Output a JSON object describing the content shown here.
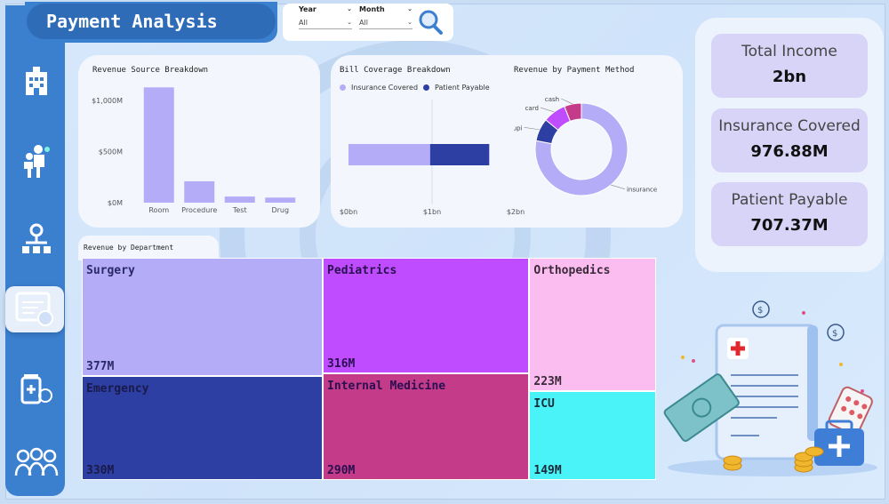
{
  "title": "Payment Analysis",
  "filters": {
    "year_label": "Year",
    "year_value": "All",
    "month_label": "Month",
    "month_value": "All"
  },
  "sidebar": {
    "items": [
      {
        "icon": "hospital-icon"
      },
      {
        "icon": "staff-icon"
      },
      {
        "icon": "org-chart-icon"
      },
      {
        "icon": "billing-icon",
        "active": true
      },
      {
        "icon": "medicine-icon"
      },
      {
        "icon": "patients-icon"
      }
    ]
  },
  "revenue_source": {
    "title": "Revenue Source Breakdown",
    "chart_data": {
      "type": "bar",
      "categories": [
        "Room",
        "Procedure",
        "Test",
        "Drug"
      ],
      "values": [
        1130,
        210,
        60,
        50
      ],
      "ylim": [
        0,
        1150
      ],
      "yticks": [
        "$0M",
        "$500M",
        "$1,000M"
      ],
      "ytick_values": [
        0,
        500,
        1000
      ],
      "color": "#b5acf8"
    }
  },
  "bill_coverage": {
    "title": "Bill Coverage Breakdown",
    "chart_data": {
      "type": "bar",
      "orientation": "horizontal",
      "stacked": true,
      "series": [
        {
          "name": "Insurance Covered",
          "values": [
            976.88
          ],
          "color": "#b5acf8"
        },
        {
          "name": "Patient Payable",
          "values": [
            707.37
          ],
          "color": "#2e3fa3"
        }
      ],
      "xticks": [
        "$0bn",
        "$1bn",
        "$2bn"
      ],
      "xtick_values": [
        0,
        1000,
        2000
      ],
      "xlim": [
        0,
        2000
      ]
    }
  },
  "payment_method": {
    "title": "Revenue by Payment Method",
    "chart_data": {
      "type": "pie",
      "donut": true,
      "labels": [
        "insurance",
        "upi",
        "card",
        "cash"
      ],
      "values": [
        78,
        8,
        8,
        6
      ],
      "colors": [
        "#b5acf8",
        "#2e3fa3",
        "#c04cff",
        "#c43b8a"
      ]
    }
  },
  "kpis": [
    {
      "label": "Total Income",
      "value": "2bn"
    },
    {
      "label": "Insurance Covered",
      "value": "976.88M"
    },
    {
      "label": "Patient Payable",
      "value": "707.37M"
    }
  ],
  "department": {
    "title": "Revenue by Department",
    "chart_data": {
      "type": "treemap",
      "items": [
        {
          "name": "Surgery",
          "value": 377,
          "label": "377M",
          "color": "#b5acf8",
          "text": "#2a2a6a"
        },
        {
          "name": "Emergency",
          "value": 330,
          "label": "330M",
          "color": "#2e3fa3",
          "text": "#1a1a4a"
        },
        {
          "name": "Pediatrics",
          "value": 316,
          "label": "316M",
          "color": "#c04cff",
          "text": "#2a1050"
        },
        {
          "name": "Internal Medicine",
          "value": 290,
          "label": "290M",
          "color": "#c43b8a",
          "text": "#2a1050"
        },
        {
          "name": "Orthopedics",
          "value": 223,
          "label": "223M",
          "color": "#fbbdf0",
          "text": "#3a2a3a"
        },
        {
          "name": "ICU",
          "value": 149,
          "label": "149M",
          "color": "#4af3f7",
          "text": "#1a2a3a"
        }
      ]
    }
  }
}
